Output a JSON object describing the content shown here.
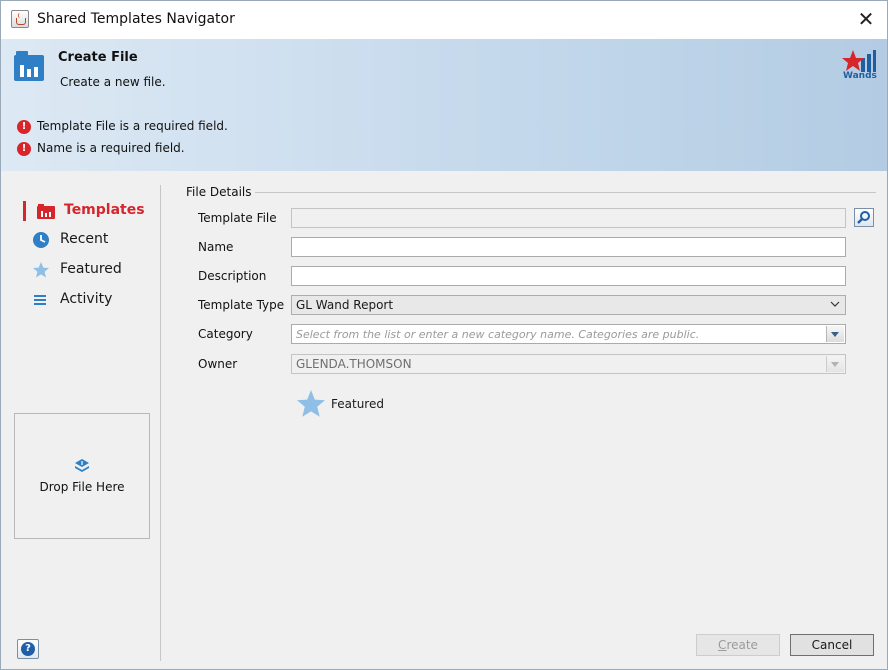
{
  "window": {
    "title": "Shared Templates Navigator"
  },
  "banner": {
    "title": "Create File",
    "subtitle": "Create a new file.",
    "logo_text": "Wands",
    "errors": [
      "Template File is a required field.",
      "Name is a required field."
    ]
  },
  "sidebar": {
    "items": [
      {
        "label": "Templates",
        "icon": "templates-icon",
        "active": true
      },
      {
        "label": "Recent",
        "icon": "clock-icon"
      },
      {
        "label": "Featured",
        "icon": "star-icon"
      },
      {
        "label": "Activity",
        "icon": "activity-list-icon"
      }
    ],
    "drop_zone": "Drop File Here",
    "help": "?"
  },
  "form": {
    "group_title": "File Details",
    "template_file": {
      "label": "Template File",
      "value": ""
    },
    "name": {
      "label": "Name",
      "value": ""
    },
    "description": {
      "label": "Description",
      "value": ""
    },
    "template_type": {
      "label": "Template Type",
      "value": "GL Wand Report"
    },
    "category": {
      "label": "Category",
      "placeholder": "Select from the list or enter a new category name. Categories are public."
    },
    "owner": {
      "label": "Owner",
      "value": "GLENDA.THOMSON"
    },
    "featured": {
      "label": "Featured"
    }
  },
  "buttons": {
    "create_first": "C",
    "create_rest": "reate",
    "cancel": "Cancel"
  },
  "colors": {
    "accent": "#d6262c",
    "banner": "#c5d9ec",
    "link_blue": "#1f5fa8"
  }
}
